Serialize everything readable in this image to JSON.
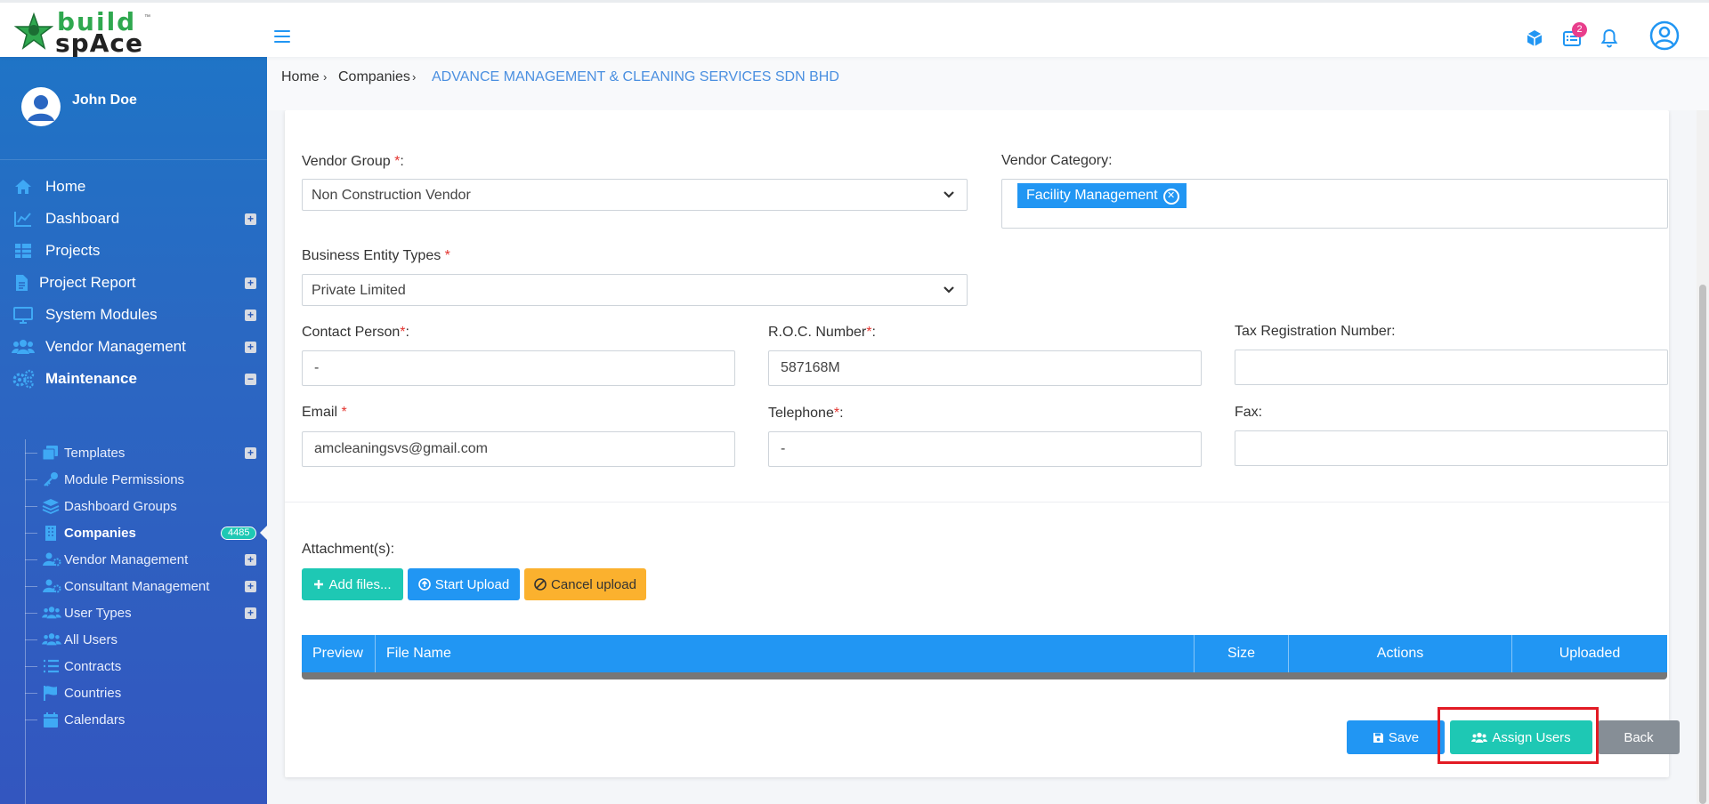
{
  "header": {
    "logo_word1": "build",
    "logo_word2": "spAce",
    "logo_tm": "™",
    "notification_count": "2"
  },
  "sidebar": {
    "user_name": "John Doe",
    "items": [
      {
        "label": "Home"
      },
      {
        "label": "Dashboard"
      },
      {
        "label": "Projects"
      },
      {
        "label": "Project Report"
      },
      {
        "label": "System Modules"
      },
      {
        "label": "Vendor Management"
      },
      {
        "label": "Maintenance"
      }
    ],
    "sub_items": [
      {
        "label": "Templates"
      },
      {
        "label": "Module Permissions"
      },
      {
        "label": "Dashboard Groups"
      },
      {
        "label": "Companies",
        "badge": "4485"
      },
      {
        "label": "Vendor Management"
      },
      {
        "label": "Consultant Management"
      },
      {
        "label": "User Types"
      },
      {
        "label": "All Users"
      },
      {
        "label": "Contracts"
      },
      {
        "label": "Countries"
      },
      {
        "label": "Calendars"
      }
    ]
  },
  "breadcrumb": {
    "home": "Home",
    "companies": "Companies",
    "current": "ADVANCE MANAGEMENT & CLEANING SERVICES SDN BHD"
  },
  "form": {
    "vendor_group_label": "Vendor Group ",
    "vendor_group_req": "*",
    "vendor_group_suffix": ":",
    "vendor_group_value": "Non Construction Vendor",
    "vendor_category_label": "Vendor Category:",
    "vendor_category_tag": "Facility Management",
    "business_entity_label": "Business Entity Types ",
    "business_entity_req": "*",
    "business_entity_value": "Private Limited",
    "contact_person_label": "Contact Person",
    "contact_person_req": "*",
    "contact_person_suffix": ":",
    "contact_person_value": "-",
    "roc_label": "R.O.C. Number",
    "roc_req": "*",
    "roc_suffix": ":",
    "roc_value": "587168M",
    "tax_label": "Tax Registration Number:",
    "tax_value": "",
    "email_label": "Email ",
    "email_req": "*",
    "email_value": "amcleaningsvs@gmail.com",
    "telephone_label": "Telephone",
    "telephone_req": "*",
    "telephone_suffix": ":",
    "telephone_value": "-",
    "fax_label": "Fax:",
    "fax_value": ""
  },
  "attachments": {
    "label": "Attachment(s):",
    "add_files": "Add files...",
    "start_upload": "Start Upload",
    "cancel_upload": "Cancel upload",
    "columns": [
      "Preview",
      "File Name",
      "Size",
      "Actions",
      "Uploaded"
    ]
  },
  "actions": {
    "save": "Save",
    "assign_users": "Assign Users",
    "back": "Back"
  },
  "colors": {
    "primary": "#2196f3",
    "teal": "#1ec8b4",
    "warning": "#fbb12e",
    "secondary": "#868e96",
    "highlight": "#e21b24"
  }
}
